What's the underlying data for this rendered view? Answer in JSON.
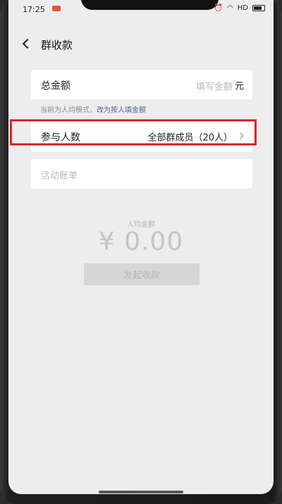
{
  "status": {
    "time": "17:25",
    "signal": "HD"
  },
  "nav": {
    "title": "群收款"
  },
  "total": {
    "label": "总金额",
    "placeholder": "填写金额",
    "unit": "元"
  },
  "hint": {
    "text": "当前为人均模式，",
    "link": "改为按人填金额"
  },
  "members": {
    "label": "参与人数",
    "value": "全部群成员（20人）"
  },
  "bill": {
    "placeholder": "活动账单"
  },
  "average": {
    "label": "人均金额",
    "amount": "¥ 0.00"
  },
  "submit": {
    "label": "发起收款"
  },
  "colors": {
    "highlight": "#e0242b",
    "link": "#50628c",
    "background": "#ededed"
  }
}
